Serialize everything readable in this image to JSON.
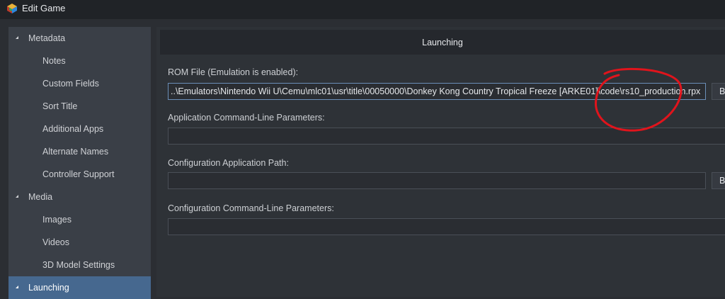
{
  "window": {
    "title": "Edit Game"
  },
  "sidebar": {
    "items": [
      {
        "label": "Metadata",
        "level": 0,
        "expanded": true
      },
      {
        "label": "Notes",
        "level": 1
      },
      {
        "label": "Custom Fields",
        "level": 1
      },
      {
        "label": "Sort Title",
        "level": 1
      },
      {
        "label": "Additional Apps",
        "level": 1
      },
      {
        "label": "Alternate Names",
        "level": 1
      },
      {
        "label": "Controller Support",
        "level": 1
      },
      {
        "label": "Media",
        "level": 0,
        "expanded": true
      },
      {
        "label": "Images",
        "level": 1
      },
      {
        "label": "Videos",
        "level": 1
      },
      {
        "label": "3D Model Settings",
        "level": 1
      },
      {
        "label": "Launching",
        "level": 0,
        "expanded": true,
        "selected": true
      }
    ]
  },
  "main": {
    "section_title": "Launching",
    "rom_file": {
      "label": "ROM File (Emulation is enabled):",
      "value": "..\\Emulators\\Nintendo Wii U\\Cemu\\mlc01\\usr\\title\\00050000\\Donkey Kong Country Tropical Freeze [ARKE01]\\code\\rs10_production.rpx",
      "browse_label": "Browse"
    },
    "app_params": {
      "label": "Application Command-Line Parameters:",
      "value": ""
    },
    "config_path": {
      "label": "Configuration Application Path:",
      "value": "",
      "browse_label": "Browse"
    },
    "config_params": {
      "label": "Configuration Command-Line Parameters:",
      "value": ""
    }
  },
  "annotation": {
    "color": "#e0141c",
    "shape": "hand-drawn circle around rs10_production.rpx"
  },
  "colors": {
    "selected": "#46688f",
    "background": "#2b2e33",
    "sidebar": "#3a3f47"
  }
}
